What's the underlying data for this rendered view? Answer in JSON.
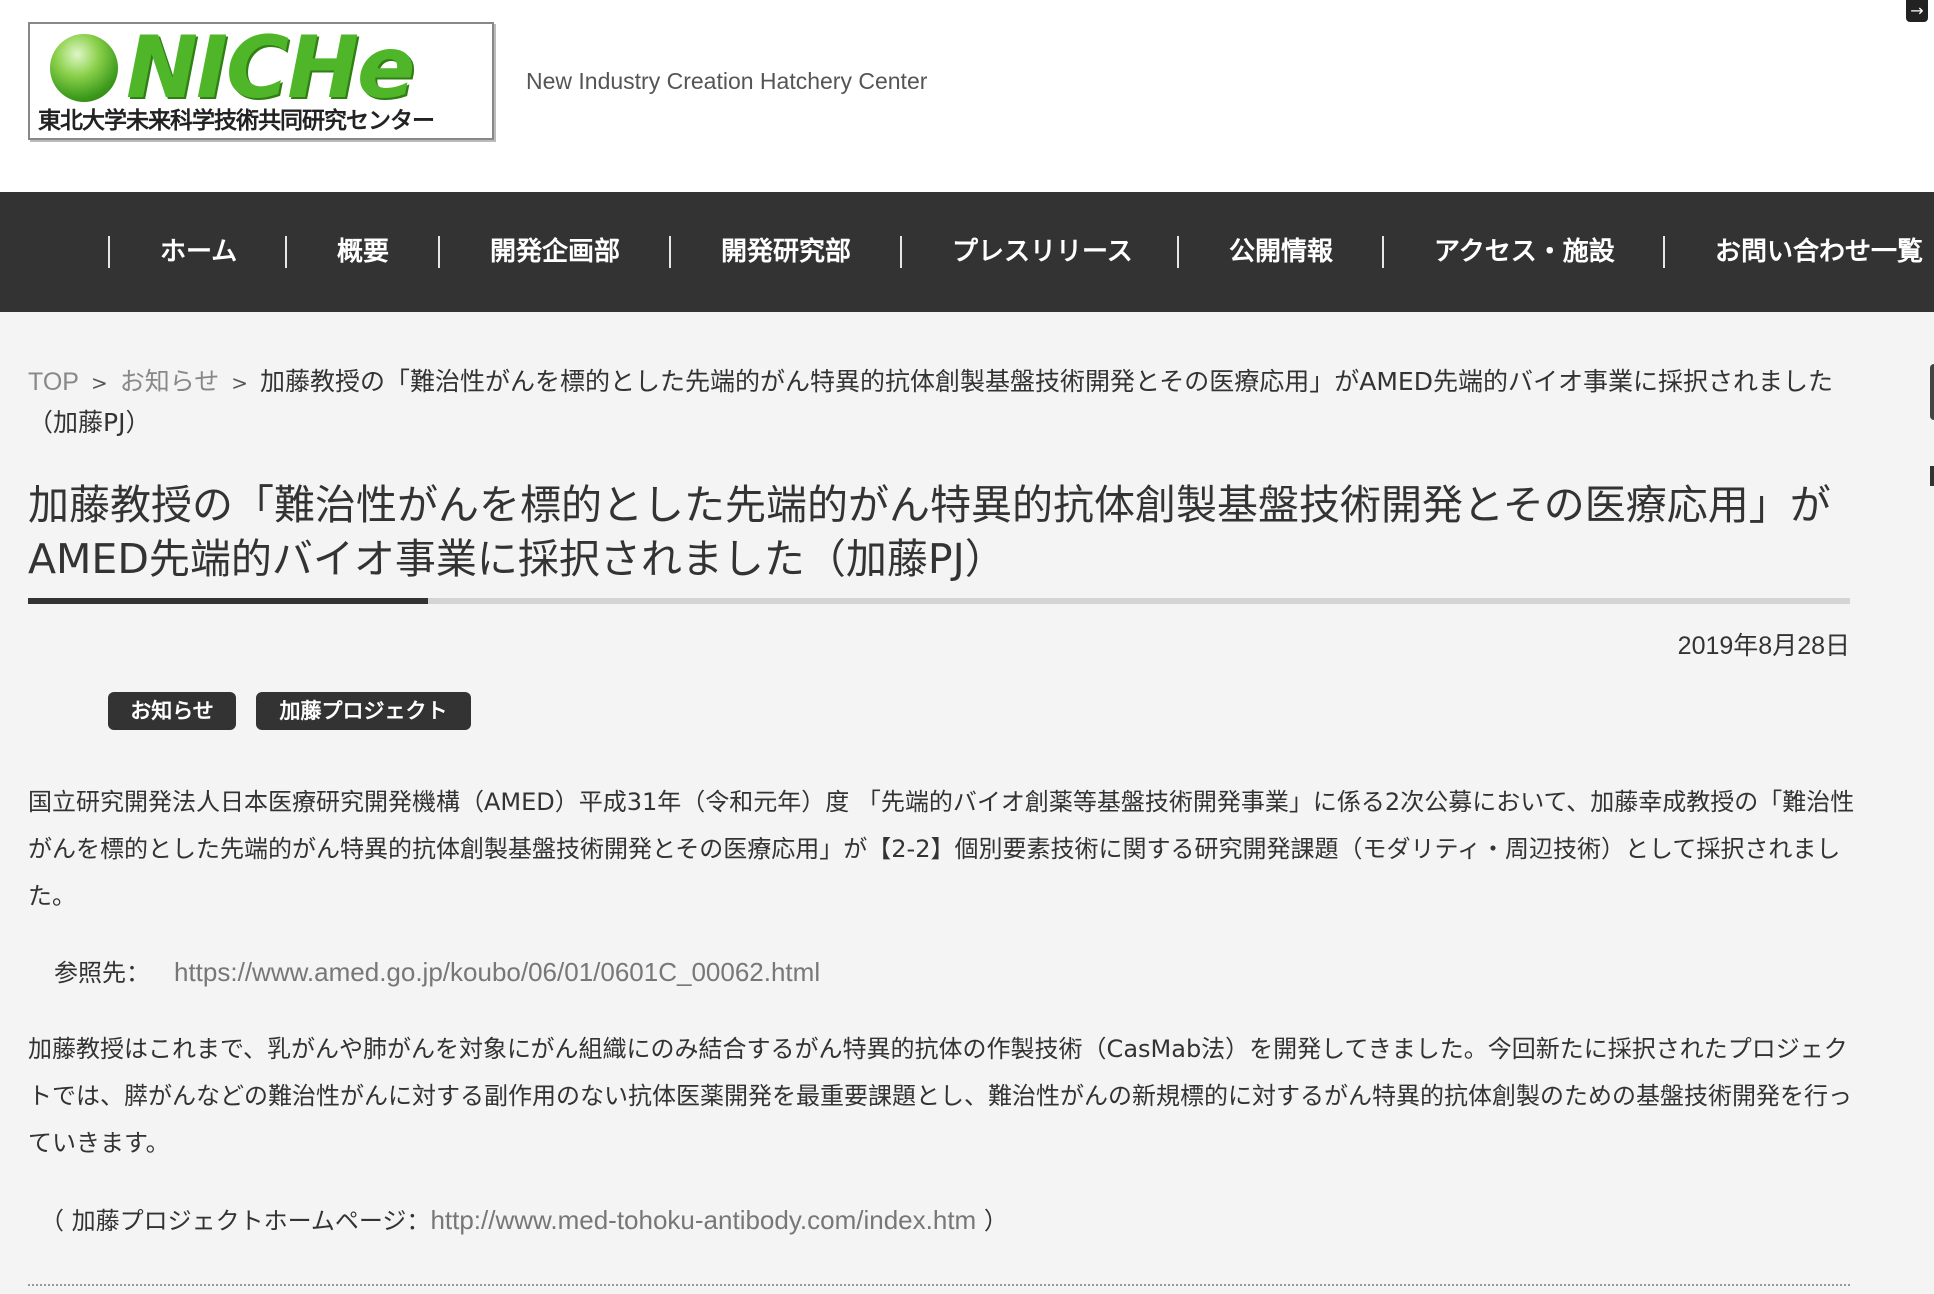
{
  "header": {
    "logo_word": "NICHe",
    "logo_subtitle": "東北大学未来科学技術共同研究センター",
    "tagline": "New Industry Creation Hatchery Center",
    "corner_icon": "exit-icon"
  },
  "nav": {
    "items": [
      {
        "label": "ホーム"
      },
      {
        "label": "概要"
      },
      {
        "label": "開発企画部"
      },
      {
        "label": "開発研究部"
      },
      {
        "label": "プレスリリース"
      },
      {
        "label": "公開情報"
      },
      {
        "label": "アクセス・施設"
      },
      {
        "label": "お問い合わせ一覧"
      }
    ]
  },
  "breadcrumb": {
    "top": "TOP",
    "news": "お知らせ",
    "separator": ">",
    "current": "加藤教授の「難治性がんを標的とした先端的がん特異的抗体創製基盤技術開発とその医療応用」がAMED先端的バイオ事業に採択されました（加藤PJ）"
  },
  "article": {
    "title": "加藤教授の「難治性がんを標的とした先端的がん特異的抗体創製基盤技術開発とその医療応用」がAMED先端的バイオ事業に採択されました（加藤PJ）",
    "date": "2019年8月28日",
    "tags": [
      "お知らせ",
      "加藤プロジェクト"
    ],
    "paragraph1": "国立研究開発法人日本医療研究開発機構（AMED）平成31年（令和元年）度 「先端的バイオ創薬等基盤技術開発事業」に係る2次公募において、加藤幸成教授の「難治性がんを標的とした先端的がん特異的抗体創製基盤技術開発とその医療応用」が【2-2】個別要素技術に関する研究開発課題（モダリティ・周辺技術）として採択されました。",
    "reference_label": "参照先：",
    "reference_url": "https://www.amed.go.jp/koubo/06/01/0601C_00062.html",
    "paragraph2": "加藤教授はこれまで、乳がんや肺がんを対象にがん組織にのみ結合するがん特異的抗体の作製技術（CasMab法）を開発してきました。今回新たに採択されたプロジェクトでは、膵がんなどの難治性がんに対する副作用のない抗体医薬開発を最重要課題とし、難治性がんの新規標的に対するがん特異的抗体創製のための基盤技術開発を行っていきます。",
    "home_open": "（ 加藤プロジェクトホームページ：",
    "home_url": "http://www.med-tohoku-antibody.com/index.htm",
    "home_close": " ）"
  },
  "colors": {
    "nav_bg": "#333333",
    "page_bg": "#f4f4f4",
    "logo_green": "#4fb62a",
    "link_gray": "#777777"
  }
}
